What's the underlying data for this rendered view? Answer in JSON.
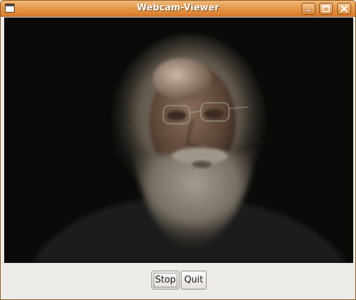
{
  "window": {
    "title": "Webcam-Viewer",
    "accent_color": "#e28a3c"
  },
  "titlebar_controls": {
    "menu_icon": "window-menu-icon",
    "minimize_icon": "minimize-icon",
    "maximize_icon": "maximize-icon",
    "close_icon": "close-icon"
  },
  "video": {
    "content": "live webcam frame"
  },
  "buttons": {
    "stop_label": "Stop",
    "quit_label": "Quit"
  }
}
